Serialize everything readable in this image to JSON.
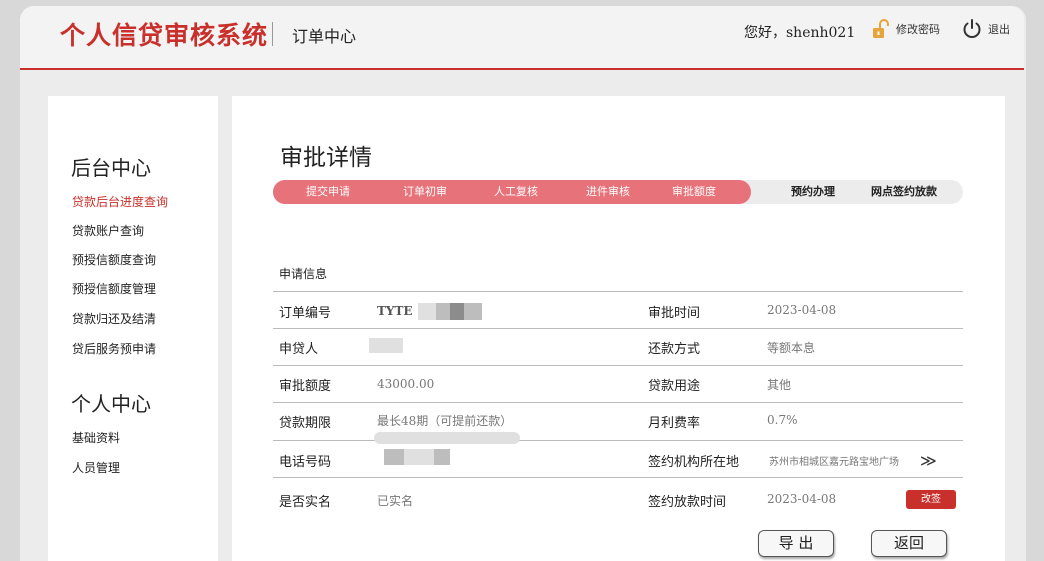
{
  "header": {
    "app_title": "个人信贷审核系统",
    "section": "订单中心",
    "greeting": "您好，shenh021",
    "change_password": "修改密码",
    "logout": "退出"
  },
  "sidebar": {
    "group1_title": "后台中心",
    "group1_items": [
      {
        "label": "贷款后台进度查询",
        "active": true
      },
      {
        "label": "贷款账户查询"
      },
      {
        "label": "预授信额度查询"
      },
      {
        "label": "预授信额度管理"
      },
      {
        "label": "贷款归还及结清"
      },
      {
        "label": "贷后服务预申请"
      }
    ],
    "group2_title": "个人中心",
    "group2_items": [
      {
        "label": "基础资料"
      },
      {
        "label": "人员管理"
      }
    ]
  },
  "main": {
    "title": "审批详情",
    "steps": [
      {
        "label": "提交申请",
        "done": true
      },
      {
        "label": "订单初审",
        "done": true
      },
      {
        "label": "人工复核",
        "done": true
      },
      {
        "label": "进件审核",
        "done": true
      },
      {
        "label": "审批额度",
        "done": true
      },
      {
        "label": "预约办理",
        "done": false
      },
      {
        "label": "网点签约放款",
        "done": false
      }
    ],
    "info_caption": "申请信息",
    "rows": [
      {
        "left_label": "订单编号",
        "left_value": "TYTE",
        "right_label": "审批时间",
        "right_value": "2023-04-08"
      },
      {
        "left_label": "申贷人",
        "left_value": "",
        "right_label": "还款方式",
        "right_value": "等额本息"
      },
      {
        "left_label": "审批额度",
        "left_value": "43000.00",
        "right_label": "贷款用途",
        "right_value": "其他"
      },
      {
        "left_label": "贷款期限",
        "left_value": "最长48期（可提前还款）",
        "right_label": "月利费率",
        "right_value": "0.7%"
      },
      {
        "left_label": "电话号码",
        "left_value": "",
        "right_label": "签约机构所在地",
        "right_value": "苏州市相城区嘉元路宝地广场"
      },
      {
        "left_label": "是否实名",
        "left_value": "已实名",
        "right_label": "签约放款时间",
        "right_value": "2023-04-08"
      }
    ],
    "more_arrow": "≫",
    "change_sign_button": "改签",
    "export_button": "导 出",
    "back_button": "返回"
  },
  "colors": {
    "brand_red": "#c9302c",
    "step_active": "#e8727a",
    "step_inactive": "#ececec"
  }
}
